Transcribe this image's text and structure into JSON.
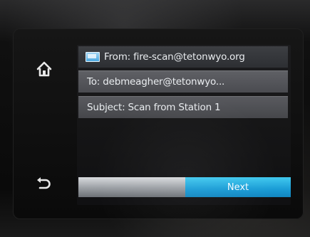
{
  "screen": {
    "from": {
      "icon": "envelope-icon",
      "label": "From: fire-scan@tetonwyo.org"
    },
    "to": {
      "label": "To: debmeagher@tetonwyo..."
    },
    "subject": {
      "label": "Subject: Scan from Station 1"
    },
    "next_label": "Next"
  },
  "keys": {
    "home_icon": "home-icon",
    "back_icon": "back-icon"
  },
  "colors": {
    "accent": "#1a9cd6",
    "row_bg": "#4a4b50"
  }
}
